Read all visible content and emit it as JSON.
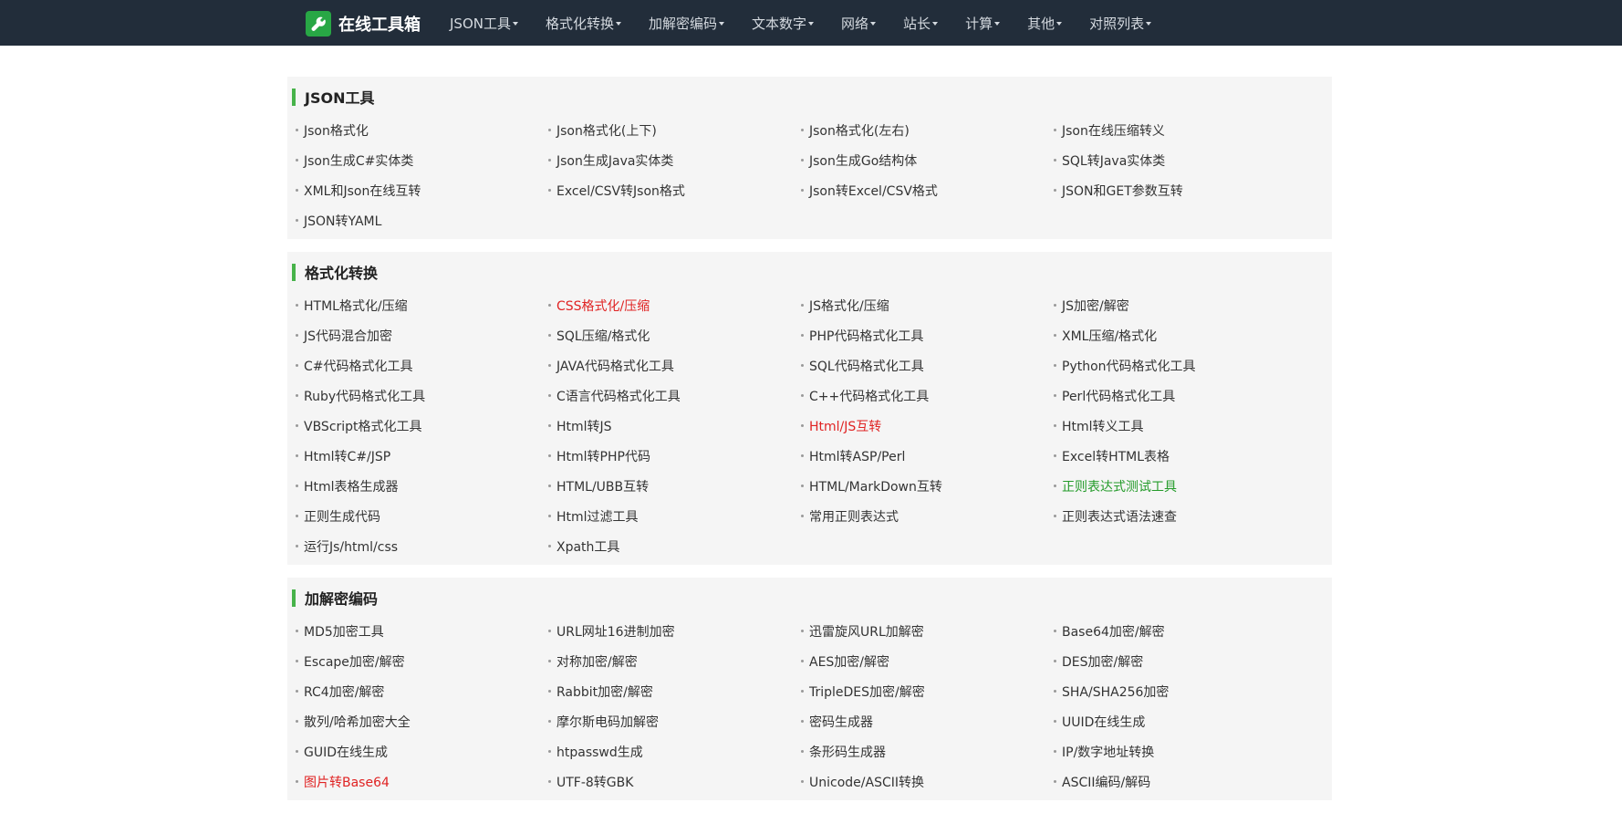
{
  "header": {
    "brand": "在线工具箱",
    "brand_icon": "wrench-icon",
    "nav": [
      "JSON工具",
      "格式化转换",
      "加解密编码",
      "文本数字",
      "网络",
      "站长",
      "计算",
      "其他",
      "对照列表"
    ]
  },
  "colors": {
    "topbar": "#222d3a",
    "brand_icon_bg": "#28a745",
    "section_marker": "#47b34a",
    "highlight_red": "#e02323",
    "highlight_green": "#249b2a",
    "panel_bg": "#f5f5f5"
  },
  "sections": [
    {
      "title": "JSON工具",
      "items": [
        {
          "label": "Json格式化"
        },
        {
          "label": "Json格式化(上下)"
        },
        {
          "label": "Json格式化(左右)"
        },
        {
          "label": "Json在线压缩转义"
        },
        {
          "label": "Json生成C#实体类"
        },
        {
          "label": "Json生成Java实体类"
        },
        {
          "label": "Json生成Go结构体"
        },
        {
          "label": "SQL转Java实体类"
        },
        {
          "label": "XML和Json在线互转"
        },
        {
          "label": "Excel/CSV转Json格式"
        },
        {
          "label": "Json转Excel/CSV格式"
        },
        {
          "label": "JSON和GET参数互转"
        },
        {
          "label": "JSON转YAML"
        }
      ]
    },
    {
      "title": "格式化转换",
      "items": [
        {
          "label": "HTML格式化/压缩"
        },
        {
          "label": "CSS格式化/压缩",
          "color": "red"
        },
        {
          "label": "JS格式化/压缩"
        },
        {
          "label": "JS加密/解密"
        },
        {
          "label": "JS代码混合加密"
        },
        {
          "label": "SQL压缩/格式化"
        },
        {
          "label": "PHP代码格式化工具"
        },
        {
          "label": "XML压缩/格式化"
        },
        {
          "label": "C#代码格式化工具"
        },
        {
          "label": "JAVA代码格式化工具"
        },
        {
          "label": "SQL代码格式化工具"
        },
        {
          "label": "Python代码格式化工具"
        },
        {
          "label": "Ruby代码格式化工具"
        },
        {
          "label": "C语言代码格式化工具"
        },
        {
          "label": "C++代码格式化工具"
        },
        {
          "label": "Perl代码格式化工具"
        },
        {
          "label": "VBScript格式化工具"
        },
        {
          "label": "Html转JS"
        },
        {
          "label": "Html/JS互转",
          "color": "red"
        },
        {
          "label": "Html转义工具"
        },
        {
          "label": "Html转C#/JSP"
        },
        {
          "label": "Html转PHP代码"
        },
        {
          "label": "Html转ASP/Perl"
        },
        {
          "label": "Excel转HTML表格"
        },
        {
          "label": "Html表格生成器"
        },
        {
          "label": "HTML/UBB互转"
        },
        {
          "label": "HTML/MarkDown互转"
        },
        {
          "label": "正则表达式测试工具",
          "color": "green"
        },
        {
          "label": "正则生成代码"
        },
        {
          "label": "Html过滤工具"
        },
        {
          "label": "常用正则表达式"
        },
        {
          "label": "正则表达式语法速查"
        },
        {
          "label": "运行Js/html/css"
        },
        {
          "label": "Xpath工具"
        }
      ]
    },
    {
      "title": "加解密编码",
      "items": [
        {
          "label": "MD5加密工具"
        },
        {
          "label": "URL网址16进制加密"
        },
        {
          "label": "迅雷旋风URL加解密"
        },
        {
          "label": "Base64加密/解密"
        },
        {
          "label": "Escape加密/解密"
        },
        {
          "label": "对称加密/解密"
        },
        {
          "label": "AES加密/解密"
        },
        {
          "label": "DES加密/解密"
        },
        {
          "label": "RC4加密/解密"
        },
        {
          "label": "Rabbit加密/解密"
        },
        {
          "label": "TripleDES加密/解密"
        },
        {
          "label": "SHA/SHA256加密"
        },
        {
          "label": "散列/哈希加密大全"
        },
        {
          "label": "摩尔斯电码加解密"
        },
        {
          "label": "密码生成器"
        },
        {
          "label": "UUID在线生成"
        },
        {
          "label": "GUID在线生成"
        },
        {
          "label": "htpasswd生成"
        },
        {
          "label": "条形码生成器"
        },
        {
          "label": "IP/数字地址转换"
        },
        {
          "label": "图片转Base64",
          "color": "red"
        },
        {
          "label": "UTF-8转GBK"
        },
        {
          "label": "Unicode/ASCII转换"
        },
        {
          "label": "ASCII编码/解码"
        }
      ]
    }
  ]
}
